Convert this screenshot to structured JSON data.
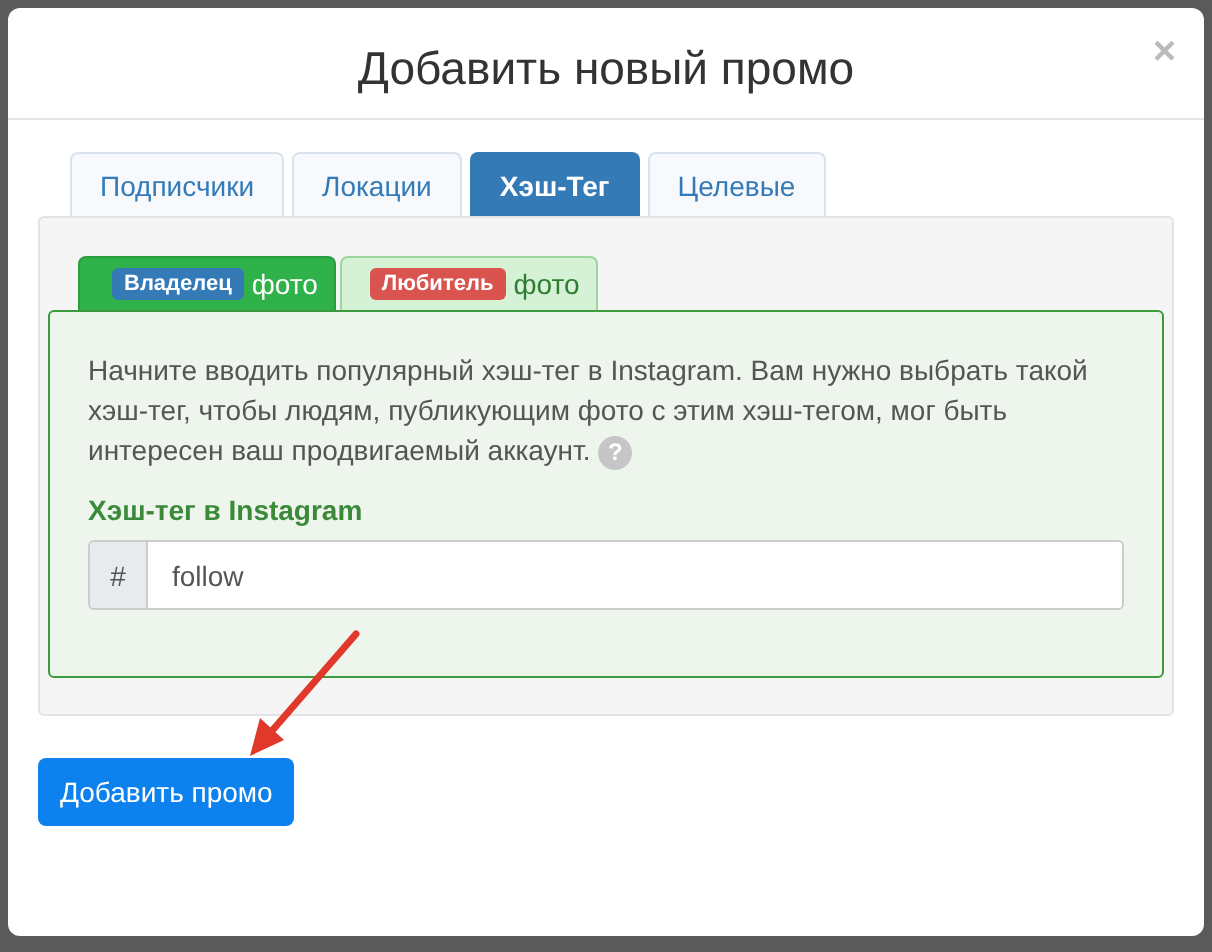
{
  "dialog": {
    "title": "Добавить новый промо",
    "close": "×"
  },
  "tabs": [
    {
      "label": "Подписчики",
      "selected": false
    },
    {
      "label": "Локации",
      "selected": false
    },
    {
      "label": "Хэш-Тег",
      "selected": true
    },
    {
      "label": "Целевые",
      "selected": false
    }
  ],
  "sub_tabs": [
    {
      "badge": "Владелец",
      "label": "фото",
      "selected": true,
      "color": "#337ab7"
    },
    {
      "badge": "Любитель",
      "label": "фото",
      "selected": false,
      "color": "#d9534f"
    }
  ],
  "description": "Начните вводить популярный хэш-тег в Instagram. Вам нужно выбрать такой хэш-тег, чтобы людям, публикующим фото с этим хэш-тегом, мог быть интересен ваш продвигаемый аккаунт.",
  "help": "?",
  "field": {
    "label": "Хэш-тег в Instagram",
    "prefix": "#",
    "value": "follow"
  },
  "submit": "Добавить промо"
}
